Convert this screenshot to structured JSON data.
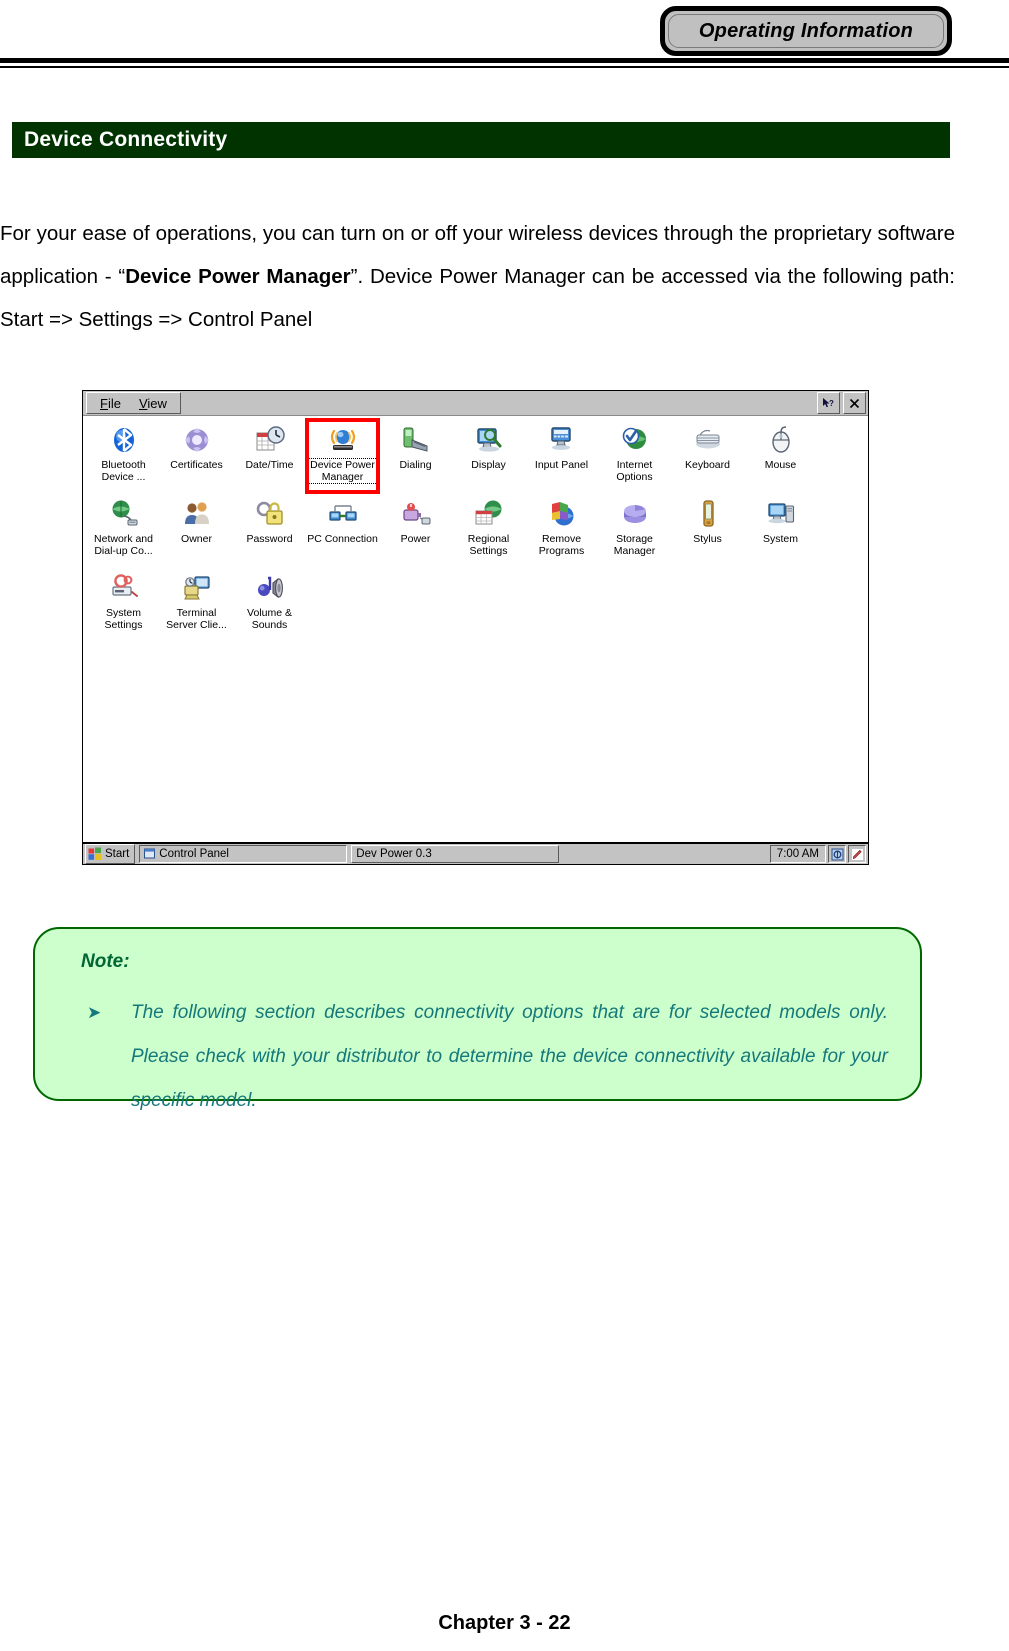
{
  "header": {
    "badge_label": "Operating Information"
  },
  "section": {
    "title": "Device Connectivity"
  },
  "body": {
    "paragraph_part1": "For your ease of operations, you can turn on or off your wireless devices through the proprietary software application - “",
    "paragraph_bold": "Device Power Manager",
    "paragraph_part2": "”. Device Power Manager can be accessed via the following path: Start => Settings => Control Panel"
  },
  "control_panel": {
    "menu": [
      {
        "label": "File",
        "accel": "F"
      },
      {
        "label": "View",
        "accel": "V"
      }
    ],
    "window_buttons": [
      {
        "name": "help-button",
        "glyph": "?"
      },
      {
        "name": "close-button",
        "glyph": "×"
      }
    ],
    "icons": [
      {
        "label": "Bluetooth Device ...",
        "icon": "bluetooth-icon",
        "selected": false
      },
      {
        "label": "Certificates",
        "icon": "certificates-icon",
        "selected": false
      },
      {
        "label": "Date/Time",
        "icon": "date-time-icon",
        "selected": false
      },
      {
        "label": "Device Power Manager",
        "icon": "device-power-manager-icon",
        "selected": true
      },
      {
        "label": "Dialing",
        "icon": "dialing-icon",
        "selected": false
      },
      {
        "label": "Display",
        "icon": "display-icon",
        "selected": false
      },
      {
        "label": "Input Panel",
        "icon": "input-panel-icon",
        "selected": false
      },
      {
        "label": "Internet Options",
        "icon": "internet-options-icon",
        "selected": false
      },
      {
        "label": "Keyboard",
        "icon": "keyboard-icon",
        "selected": false
      },
      {
        "label": "Mouse",
        "icon": "mouse-icon",
        "selected": false
      },
      {
        "label": "Network and Dial-up Co...",
        "icon": "network-dialup-icon",
        "selected": false
      },
      {
        "label": "Owner",
        "icon": "owner-icon",
        "selected": false
      },
      {
        "label": "Password",
        "icon": "password-icon",
        "selected": false
      },
      {
        "label": "PC Connection",
        "icon": "pc-connection-icon",
        "selected": false
      },
      {
        "label": "Power",
        "icon": "power-icon",
        "selected": false
      },
      {
        "label": "Regional Settings",
        "icon": "regional-settings-icon",
        "selected": false
      },
      {
        "label": "Remove Programs",
        "icon": "remove-programs-icon",
        "selected": false
      },
      {
        "label": "Storage Manager",
        "icon": "storage-manager-icon",
        "selected": false
      },
      {
        "label": "Stylus",
        "icon": "stylus-icon",
        "selected": false
      },
      {
        "label": "System",
        "icon": "system-icon",
        "selected": false
      },
      {
        "label": "System Settings",
        "icon": "system-settings-icon",
        "selected": false
      },
      {
        "label": "Terminal Server Clie...",
        "icon": "terminal-server-client-icon",
        "selected": false
      },
      {
        "label": "Volume & Sounds",
        "icon": "volume-sounds-icon",
        "selected": false
      }
    ],
    "taskbar": {
      "start_label": "Start",
      "task1_label": "Control Panel",
      "task2_label": "Dev Power 0.3",
      "clock": "7:00 AM",
      "tray_icons": [
        "network-status-icon",
        "stylus-tray-icon"
      ]
    },
    "highlight_color": "#ff0000"
  },
  "note": {
    "title": "Note:",
    "items": [
      "The following section describes connectivity options that are for selected models only. Please check with your distributor to determine the device connectivity available for your specific model."
    ],
    "bullet_glyph": "➤"
  },
  "footer": {
    "page_label": "Chapter 3 - 22"
  }
}
